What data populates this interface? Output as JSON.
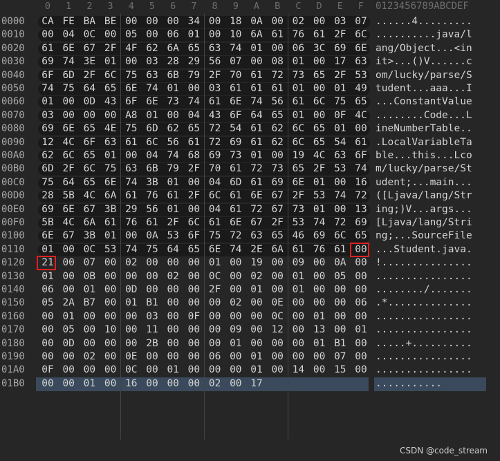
{
  "column_headers": [
    "0",
    "1",
    "2",
    "3",
    "4",
    "5",
    "6",
    "7",
    "8",
    "9",
    "A",
    "B",
    "C",
    "D",
    "E",
    "F"
  ],
  "ascii_header": "0123456789ABCDEF",
  "rows": [
    {
      "offset": "0000",
      "bytes": [
        "CA",
        "FE",
        "BA",
        "BE",
        "00",
        "00",
        "00",
        "34",
        "00",
        "18",
        "0A",
        "00",
        "02",
        "00",
        "03",
        "07"
      ],
      "ascii": "......4........."
    },
    {
      "offset": "0010",
      "bytes": [
        "00",
        "04",
        "0C",
        "00",
        "05",
        "00",
        "06",
        "01",
        "00",
        "10",
        "6A",
        "61",
        "76",
        "61",
        "2F",
        "6C"
      ],
      "ascii": "..........java/l"
    },
    {
      "offset": "0020",
      "bytes": [
        "61",
        "6E",
        "67",
        "2F",
        "4F",
        "62",
        "6A",
        "65",
        "63",
        "74",
        "01",
        "00",
        "06",
        "3C",
        "69",
        "6E"
      ],
      "ascii": "ang/Object...<in"
    },
    {
      "offset": "0030",
      "bytes": [
        "69",
        "74",
        "3E",
        "01",
        "00",
        "03",
        "28",
        "29",
        "56",
        "07",
        "00",
        "08",
        "01",
        "00",
        "17",
        "63"
      ],
      "ascii": "it>...()V......c"
    },
    {
      "offset": "0040",
      "bytes": [
        "6F",
        "6D",
        "2F",
        "6C",
        "75",
        "63",
        "6B",
        "79",
        "2F",
        "70",
        "61",
        "72",
        "73",
        "65",
        "2F",
        "53"
      ],
      "ascii": "om/lucky/parse/S"
    },
    {
      "offset": "0050",
      "bytes": [
        "74",
        "75",
        "64",
        "65",
        "6E",
        "74",
        "01",
        "00",
        "03",
        "61",
        "61",
        "61",
        "01",
        "00",
        "01",
        "49"
      ],
      "ascii": "tudent...aaa...I"
    },
    {
      "offset": "0060",
      "bytes": [
        "01",
        "00",
        "0D",
        "43",
        "6F",
        "6E",
        "73",
        "74",
        "61",
        "6E",
        "74",
        "56",
        "61",
        "6C",
        "75",
        "65"
      ],
      "ascii": "...ConstantValue"
    },
    {
      "offset": "0070",
      "bytes": [
        "03",
        "00",
        "00",
        "00",
        "A8",
        "01",
        "00",
        "04",
        "43",
        "6F",
        "64",
        "65",
        "01",
        "00",
        "0F",
        "4C"
      ],
      "ascii": "........Code...L"
    },
    {
      "offset": "0080",
      "bytes": [
        "69",
        "6E",
        "65",
        "4E",
        "75",
        "6D",
        "62",
        "65",
        "72",
        "54",
        "61",
        "62",
        "6C",
        "65",
        "01",
        "00"
      ],
      "ascii": "ineNumberTable.."
    },
    {
      "offset": "0090",
      "bytes": [
        "12",
        "4C",
        "6F",
        "63",
        "61",
        "6C",
        "56",
        "61",
        "72",
        "69",
        "61",
        "62",
        "6C",
        "65",
        "54",
        "61"
      ],
      "ascii": ".LocalVariableTa"
    },
    {
      "offset": "00A0",
      "bytes": [
        "62",
        "6C",
        "65",
        "01",
        "00",
        "04",
        "74",
        "68",
        "69",
        "73",
        "01",
        "00",
        "19",
        "4C",
        "63",
        "6F"
      ],
      "ascii": "ble...this...Lco"
    },
    {
      "offset": "00B0",
      "bytes": [
        "6D",
        "2F",
        "6C",
        "75",
        "63",
        "6B",
        "79",
        "2F",
        "70",
        "61",
        "72",
        "73",
        "65",
        "2F",
        "53",
        "74"
      ],
      "ascii": "m/lucky/parse/St"
    },
    {
      "offset": "00C0",
      "bytes": [
        "75",
        "64",
        "65",
        "6E",
        "74",
        "3B",
        "01",
        "00",
        "04",
        "6D",
        "61",
        "69",
        "6E",
        "01",
        "00",
        "16"
      ],
      "ascii": "udent;...main..."
    },
    {
      "offset": "00D0",
      "bytes": [
        "28",
        "5B",
        "4C",
        "6A",
        "61",
        "76",
        "61",
        "2F",
        "6C",
        "61",
        "6E",
        "67",
        "2F",
        "53",
        "74",
        "72"
      ],
      "ascii": "([Ljava/lang/Str"
    },
    {
      "offset": "00E0",
      "bytes": [
        "69",
        "6E",
        "67",
        "3B",
        "29",
        "56",
        "01",
        "00",
        "04",
        "61",
        "72",
        "67",
        "73",
        "01",
        "00",
        "13"
      ],
      "ascii": "ing;)V...args..."
    },
    {
      "offset": "00F0",
      "bytes": [
        "5B",
        "4C",
        "6A",
        "61",
        "76",
        "61",
        "2F",
        "6C",
        "61",
        "6E",
        "67",
        "2F",
        "53",
        "74",
        "72",
        "69"
      ],
      "ascii": "[Ljava/lang/Stri"
    },
    {
      "offset": "0100",
      "bytes": [
        "6E",
        "67",
        "3B",
        "01",
        "00",
        "0A",
        "53",
        "6F",
        "75",
        "72",
        "63",
        "65",
        "46",
        "69",
        "6C",
        "65"
      ],
      "ascii": "ng;...SourceFile"
    },
    {
      "offset": "0110",
      "bytes": [
        "01",
        "00",
        "0C",
        "53",
        "74",
        "75",
        "64",
        "65",
        "6E",
        "74",
        "2E",
        "6A",
        "61",
        "76",
        "61",
        "00"
      ],
      "ascii": "...Student.java."
    },
    {
      "offset": "0120",
      "bytes": [
        "21",
        "00",
        "07",
        "00",
        "02",
        "00",
        "00",
        "00",
        "01",
        "00",
        "19",
        "00",
        "09",
        "00",
        "0A",
        "00"
      ],
      "ascii": "!..............."
    },
    {
      "offset": "0130",
      "bytes": [
        "01",
        "00",
        "0B",
        "00",
        "00",
        "00",
        "02",
        "00",
        "0C",
        "00",
        "02",
        "00",
        "01",
        "00",
        "05",
        "00"
      ],
      "ascii": "................"
    },
    {
      "offset": "0140",
      "bytes": [
        "06",
        "00",
        "01",
        "00",
        "0D",
        "00",
        "00",
        "00",
        "2F",
        "00",
        "01",
        "00",
        "01",
        "00",
        "00",
        "00"
      ],
      "ascii": "......../......."
    },
    {
      "offset": "0150",
      "bytes": [
        "05",
        "2A",
        "B7",
        "00",
        "01",
        "B1",
        "00",
        "00",
        "00",
        "02",
        "00",
        "0E",
        "00",
        "00",
        "00",
        "06"
      ],
      "ascii": ".*.............."
    },
    {
      "offset": "0160",
      "bytes": [
        "00",
        "01",
        "00",
        "00",
        "00",
        "03",
        "00",
        "0F",
        "00",
        "00",
        "00",
        "0C",
        "00",
        "01",
        "00",
        "00"
      ],
      "ascii": "................"
    },
    {
      "offset": "0170",
      "bytes": [
        "00",
        "05",
        "00",
        "10",
        "00",
        "11",
        "00",
        "00",
        "00",
        "09",
        "00",
        "12",
        "00",
        "13",
        "00",
        "01"
      ],
      "ascii": "................"
    },
    {
      "offset": "0180",
      "bytes": [
        "00",
        "0D",
        "00",
        "00",
        "00",
        "2B",
        "00",
        "00",
        "00",
        "01",
        "00",
        "00",
        "00",
        "01",
        "B1",
        "00"
      ],
      "ascii": ".....+.........."
    },
    {
      "offset": "0190",
      "bytes": [
        "00",
        "00",
        "02",
        "00",
        "0E",
        "00",
        "00",
        "00",
        "06",
        "00",
        "01",
        "00",
        "00",
        "00",
        "07",
        "00"
      ],
      "ascii": "................"
    },
    {
      "offset": "01A0",
      "bytes": [
        "0F",
        "00",
        "00",
        "00",
        "0C",
        "00",
        "01",
        "00",
        "00",
        "00",
        "01",
        "00",
        "14",
        "00",
        "15",
        "00"
      ],
      "ascii": "................"
    },
    {
      "offset": "01B0",
      "bytes": [
        "00",
        "00",
        "01",
        "00",
        "16",
        "00",
        "00",
        "00",
        "02",
        "00",
        "17"
      ],
      "ascii": "..........."
    }
  ],
  "highlights": [
    {
      "row": 17,
      "col": 15,
      "color": "#e02020"
    },
    {
      "row": 18,
      "col": 0,
      "color": "#e02020"
    }
  ],
  "watermark": "CSDN @code_stream",
  "colors": {
    "background": "#262626",
    "text": "#d4d4d4",
    "offset_text": "#a8a8a8",
    "header_text": "#6e6e6e",
    "selection": "#3a4a5c",
    "highlight_box": "#e02020"
  }
}
